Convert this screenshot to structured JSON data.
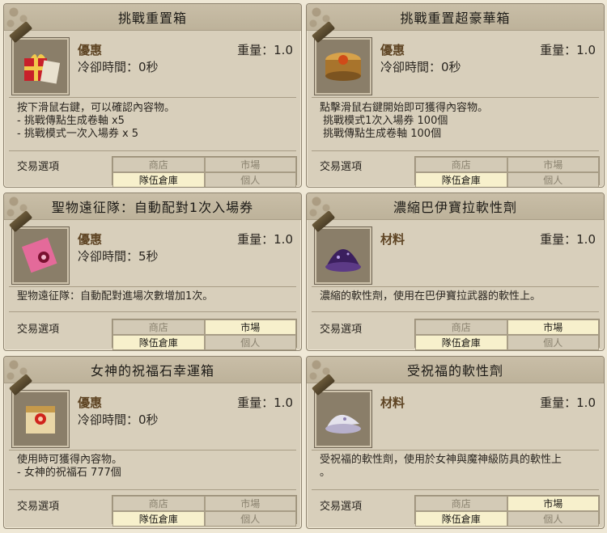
{
  "common": {
    "trade_label": "交易選項",
    "weight_label": "重量：1.0"
  },
  "cards": [
    {
      "title": "挑戰重置箱",
      "grade": "優惠",
      "cooldown": "冷卻時間：0秒",
      "desc": [
        "按下滑鼠右鍵，可以確認內容物。",
        "- 挑戰傳點生成卷軸 x5",
        "- 挑戰模式一次入場券 x 5"
      ],
      "icon": "gift-box-icon",
      "trade": [
        {
          "label": "商店",
          "on": false
        },
        {
          "label": "市場",
          "on": false
        },
        {
          "label": "隊伍倉庫",
          "on": true
        },
        {
          "label": "個人",
          "on": false
        }
      ]
    },
    {
      "title": "挑戰重置超豪華箱",
      "grade": "優惠",
      "cooldown": "冷卻時間：0秒",
      "desc": [
        "點擊滑鼠右鍵開始即可獲得內容物。",
        " 挑戰模式1次入場券 100個",
        " 挑戰傳點生成卷軸 100個"
      ],
      "icon": "deluxe-chest-icon",
      "trade": [
        {
          "label": "商店",
          "on": false
        },
        {
          "label": "市場",
          "on": false
        },
        {
          "label": "隊伍倉庫",
          "on": true
        },
        {
          "label": "個人",
          "on": false
        }
      ]
    },
    {
      "title": "聖物遠征隊：自動配對1次入場券",
      "grade": "優惠",
      "cooldown": "冷卻時間：5秒",
      "desc": [
        "聖物遠征隊：自動配對進場次數增加1次。"
      ],
      "icon": "ticket-icon",
      "trade": [
        {
          "label": "商店",
          "on": false
        },
        {
          "label": "市場",
          "on": true
        },
        {
          "label": "隊伍倉庫",
          "on": true
        },
        {
          "label": "個人",
          "on": false
        }
      ]
    },
    {
      "title": "濃縮巴伊寶拉軟性劑",
      "grade": "材料",
      "cooldown": "",
      "desc": [
        "濃縮的軟性劑，使用在巴伊寶拉武器的軟性上。"
      ],
      "icon": "purple-powder-icon",
      "trade": [
        {
          "label": "商店",
          "on": false
        },
        {
          "label": "市場",
          "on": true
        },
        {
          "label": "隊伍倉庫",
          "on": true
        },
        {
          "label": "個人",
          "on": false
        }
      ]
    },
    {
      "title": "女神的祝福石幸運箱",
      "grade": "優惠",
      "cooldown": "冷卻時間：0秒",
      "desc": [
        "使用時可獲得內容物。",
        "- 女神的祝福石 777個"
      ],
      "icon": "lucky-box-icon",
      "trade": [
        {
          "label": "商店",
          "on": false
        },
        {
          "label": "市場",
          "on": false
        },
        {
          "label": "隊伍倉庫",
          "on": true
        },
        {
          "label": "個人",
          "on": false
        }
      ]
    },
    {
      "title": "受祝福的軟性劑",
      "grade": "材料",
      "cooldown": "",
      "desc": [
        "受祝福的軟性劑，使用於女神與魔神級防具的軟性上",
        "。"
      ],
      "icon": "white-powder-icon",
      "trade": [
        {
          "label": "商店",
          "on": false
        },
        {
          "label": "市場",
          "on": true
        },
        {
          "label": "隊伍倉庫",
          "on": true
        },
        {
          "label": "個人",
          "on": false
        }
      ]
    }
  ]
}
